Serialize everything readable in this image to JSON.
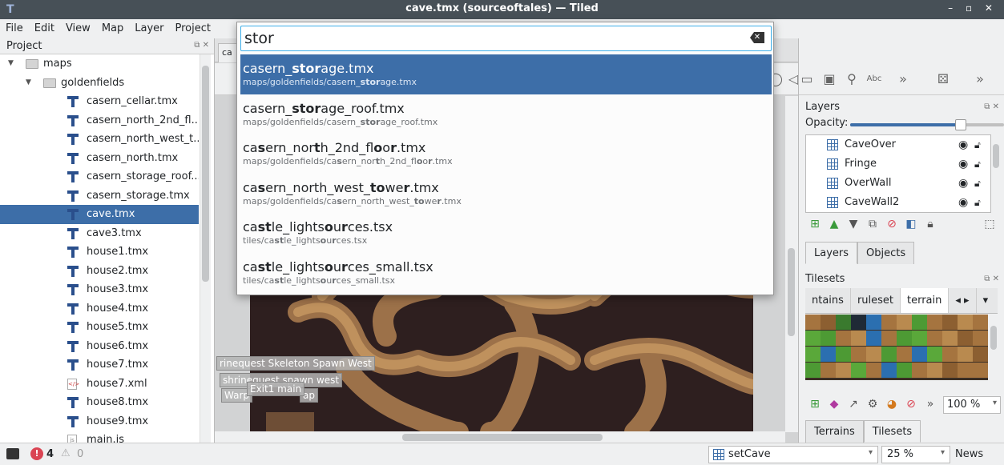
{
  "window": {
    "title": "cave.tmx (sourceoftales) — Tiled",
    "controls": "– ▫ ✕"
  },
  "menu": [
    "File",
    "Edit",
    "View",
    "Map",
    "Layer",
    "Project"
  ],
  "project": {
    "title": "Project",
    "tree": [
      {
        "label": "maps",
        "type": "folder",
        "depth": 0,
        "expanded": true
      },
      {
        "label": "goldenfields",
        "type": "folder",
        "depth": 1,
        "expanded": true
      },
      {
        "label": "casern_cellar.tmx",
        "type": "tmx",
        "depth": 2
      },
      {
        "label": "casern_north_2nd_fl...",
        "type": "tmx",
        "depth": 2
      },
      {
        "label": "casern_north_west_t...",
        "type": "tmx",
        "depth": 2
      },
      {
        "label": "casern_north.tmx",
        "type": "tmx",
        "depth": 2
      },
      {
        "label": "casern_storage_roof....",
        "type": "tmx",
        "depth": 2
      },
      {
        "label": "casern_storage.tmx",
        "type": "tmx",
        "depth": 2
      },
      {
        "label": "cave.tmx",
        "type": "tmx",
        "depth": 2,
        "selected": true
      },
      {
        "label": "cave3.tmx",
        "type": "tmx",
        "depth": 2
      },
      {
        "label": "house1.tmx",
        "type": "tmx",
        "depth": 2
      },
      {
        "label": "house2.tmx",
        "type": "tmx",
        "depth": 2
      },
      {
        "label": "house3.tmx",
        "type": "tmx",
        "depth": 2
      },
      {
        "label": "house4.tmx",
        "type": "tmx",
        "depth": 2
      },
      {
        "label": "house5.tmx",
        "type": "tmx",
        "depth": 2
      },
      {
        "label": "house6.tmx",
        "type": "tmx",
        "depth": 2
      },
      {
        "label": "house7.tmx",
        "type": "tmx",
        "depth": 2
      },
      {
        "label": "house7.xml",
        "type": "xml",
        "depth": 2
      },
      {
        "label": "house8.tmx",
        "type": "tmx",
        "depth": 2
      },
      {
        "label": "house9.tmx",
        "type": "tmx",
        "depth": 2
      },
      {
        "label": "main.js",
        "type": "js",
        "depth": 2
      }
    ]
  },
  "quick_open": {
    "query": "stor",
    "results": [
      {
        "name_parts": [
          [
            "casern_",
            false
          ],
          [
            "stor",
            true
          ],
          [
            "age.tmx",
            false
          ]
        ],
        "path_parts": [
          [
            "maps/goldenfields/casern_",
            false
          ],
          [
            "stor",
            true
          ],
          [
            "age.tmx",
            false
          ]
        ],
        "selected": true
      },
      {
        "name_parts": [
          [
            "casern_",
            false
          ],
          [
            "stor",
            true
          ],
          [
            "age_roof.tmx",
            false
          ]
        ],
        "path_parts": [
          [
            "maps/goldenfields/casern_",
            false
          ],
          [
            "stor",
            true
          ],
          [
            "age_roof.tmx",
            false
          ]
        ]
      },
      {
        "name_parts": [
          [
            "ca",
            false
          ],
          [
            "s",
            true
          ],
          [
            "ern_nor",
            false
          ],
          [
            "t",
            true
          ],
          [
            "h_2nd_fl",
            false
          ],
          [
            "o",
            true
          ],
          [
            "o",
            false
          ],
          [
            "r",
            true
          ],
          [
            ".tmx",
            false
          ]
        ],
        "path_parts": [
          [
            "maps/goldenfields/ca",
            false
          ],
          [
            "s",
            true
          ],
          [
            "ern_nor",
            false
          ],
          [
            "t",
            true
          ],
          [
            "h_2nd_fl",
            false
          ],
          [
            "o",
            true
          ],
          [
            "o",
            false
          ],
          [
            "r",
            true
          ],
          [
            ".tmx",
            false
          ]
        ]
      },
      {
        "name_parts": [
          [
            "ca",
            false
          ],
          [
            "s",
            true
          ],
          [
            "ern_north_west_",
            false
          ],
          [
            "to",
            true
          ],
          [
            "we",
            false
          ],
          [
            "r",
            true
          ],
          [
            ".tmx",
            false
          ]
        ],
        "path_parts": [
          [
            "maps/goldenfields/ca",
            false
          ],
          [
            "s",
            true
          ],
          [
            "ern_north_west_",
            false
          ],
          [
            "to",
            true
          ],
          [
            "we",
            false
          ],
          [
            "r",
            true
          ],
          [
            ".tmx",
            false
          ]
        ]
      },
      {
        "name_parts": [
          [
            "ca",
            false
          ],
          [
            "st",
            true
          ],
          [
            "le_lights",
            false
          ],
          [
            "o",
            true
          ],
          [
            "u",
            false
          ],
          [
            "r",
            true
          ],
          [
            "ces.tsx",
            false
          ]
        ],
        "path_parts": [
          [
            "tiles/ca",
            false
          ],
          [
            "st",
            true
          ],
          [
            "le_lights",
            false
          ],
          [
            "o",
            true
          ],
          [
            "u",
            false
          ],
          [
            "r",
            true
          ],
          [
            "ces.tsx",
            false
          ]
        ]
      },
      {
        "name_parts": [
          [
            "ca",
            false
          ],
          [
            "st",
            true
          ],
          [
            "le_lights",
            false
          ],
          [
            "o",
            true
          ],
          [
            "u",
            false
          ],
          [
            "r",
            true
          ],
          [
            "ces_small.tsx",
            false
          ]
        ],
        "path_parts": [
          [
            "tiles/ca",
            false
          ],
          [
            "st",
            true
          ],
          [
            "le_lights",
            false
          ],
          [
            "o",
            true
          ],
          [
            "u",
            false
          ],
          [
            "r",
            true
          ],
          [
            "ces_small.tsx",
            false
          ]
        ]
      }
    ]
  },
  "map": {
    "tab_label": "ca",
    "object_labels": [
      "rinequest Skeleton Spawn West",
      "shrinequest spawn west",
      "Warp",
      "Exit1 main",
      "ap"
    ]
  },
  "layers": {
    "title": "Layers",
    "opacity_label": "Opacity:",
    "opacity_fraction": 0.72,
    "items": [
      "CaveOver",
      "Fringe",
      "OverWall",
      "CaveWall2"
    ],
    "tabs": [
      "Layers",
      "Objects"
    ]
  },
  "tilesets": {
    "title": "Tilesets",
    "tabs": [
      "ntains",
      "ruleset",
      "terrain"
    ],
    "zoom": "100 %",
    "bottom_tabs": [
      "Terrains",
      "Tilesets"
    ]
  },
  "status": {
    "errors": "4",
    "warnings": "0",
    "current_layer": "setCave",
    "zoom": "25 %",
    "news": "News"
  },
  "colors": {
    "selection": "#3d6ea8",
    "titlebar": "#475057",
    "error": "#da4453"
  }
}
